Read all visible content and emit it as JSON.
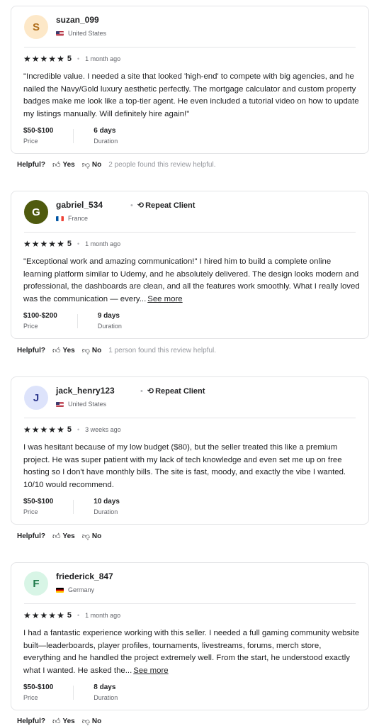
{
  "reviews": [
    {
      "initial": "S",
      "avatar_bg": "#fde8c8",
      "avatar_color": "#b06e1c",
      "username": "suzan_099",
      "repeat_client": "",
      "country": "United States",
      "flag": "us",
      "rating": "5",
      "time": "1 month ago",
      "text": "\"Incredible value. I needed a site that looked 'high-end' to compete with big agencies, and he nailed the Navy/Gold luxury aesthetic perfectly. The mortgage calculator and custom property badges make me look like a top-tier agent. He even included a tutorial video on how to update my listings manually. Will definitely hire again!\"",
      "see_more": "",
      "price": "$50-$100",
      "price_label": "Price",
      "duration": "6 days",
      "duration_label": "Duration",
      "helpful_note": "2 people found this review helpful."
    },
    {
      "initial": "G",
      "avatar_bg": "#4f5a0e",
      "avatar_color": "#ffffff",
      "username": "gabriel_534",
      "repeat_client": "Repeat Client",
      "country": "France",
      "flag": "fr",
      "rating": "5",
      "time": "1 month ago",
      "text": "\"Exceptional work and amazing communication!\" I hired him to build a complete online learning platform similar to Udemy, and he absolutely delivered. The design looks modern and professional, the dashboards are clean, and all the features work smoothly. What I really loved was the communication — every...",
      "see_more": "See more",
      "price": "$100-$200",
      "price_label": "Price",
      "duration": "9 days",
      "duration_label": "Duration",
      "helpful_note": "1 person found this review helpful."
    },
    {
      "initial": "J",
      "avatar_bg": "#dde3fb",
      "avatar_color": "#2f3a8f",
      "username": "jack_henry123",
      "repeat_client": "Repeat Client",
      "country": "United States",
      "flag": "us",
      "rating": "5",
      "time": "3 weeks ago",
      "text": "I was hesitant because of my low budget ($80), but the seller treated this like a premium project. He was super patient with my lack of tech knowledge and even set me up on free hosting so I don't have monthly bills. The site is fast, moody, and exactly the vibe I wanted. 10/10 would recommend.",
      "see_more": "",
      "price": "$50-$100",
      "price_label": "Price",
      "duration": "10 days",
      "duration_label": "Duration",
      "helpful_note": ""
    },
    {
      "initial": "F",
      "avatar_bg": "#d8f5e6",
      "avatar_color": "#1e7a4a",
      "username": "friederick_847",
      "repeat_client": "",
      "country": "Germany",
      "flag": "de",
      "rating": "5",
      "time": "1 month ago",
      "text": "I had a fantastic experience working with this seller. I needed a full gaming community website built—leaderboards, player profiles, tournaments, livestreams, forums, merch store, everything and he handled the project extremely well. From the start, he understood exactly what I wanted. He asked the...",
      "see_more": "See more",
      "price": "$50-$100",
      "price_label": "Price",
      "duration": "8 days",
      "duration_label": "Duration",
      "helpful_note": ""
    }
  ],
  "helpful": {
    "label": "Helpful?",
    "yes": "Yes",
    "no": "No"
  },
  "icons": {
    "star": "star-icon",
    "thumbs_up": "thumbs-up-icon",
    "thumbs_down": "thumbs-down-icon",
    "repeat": "repeat-icon"
  }
}
